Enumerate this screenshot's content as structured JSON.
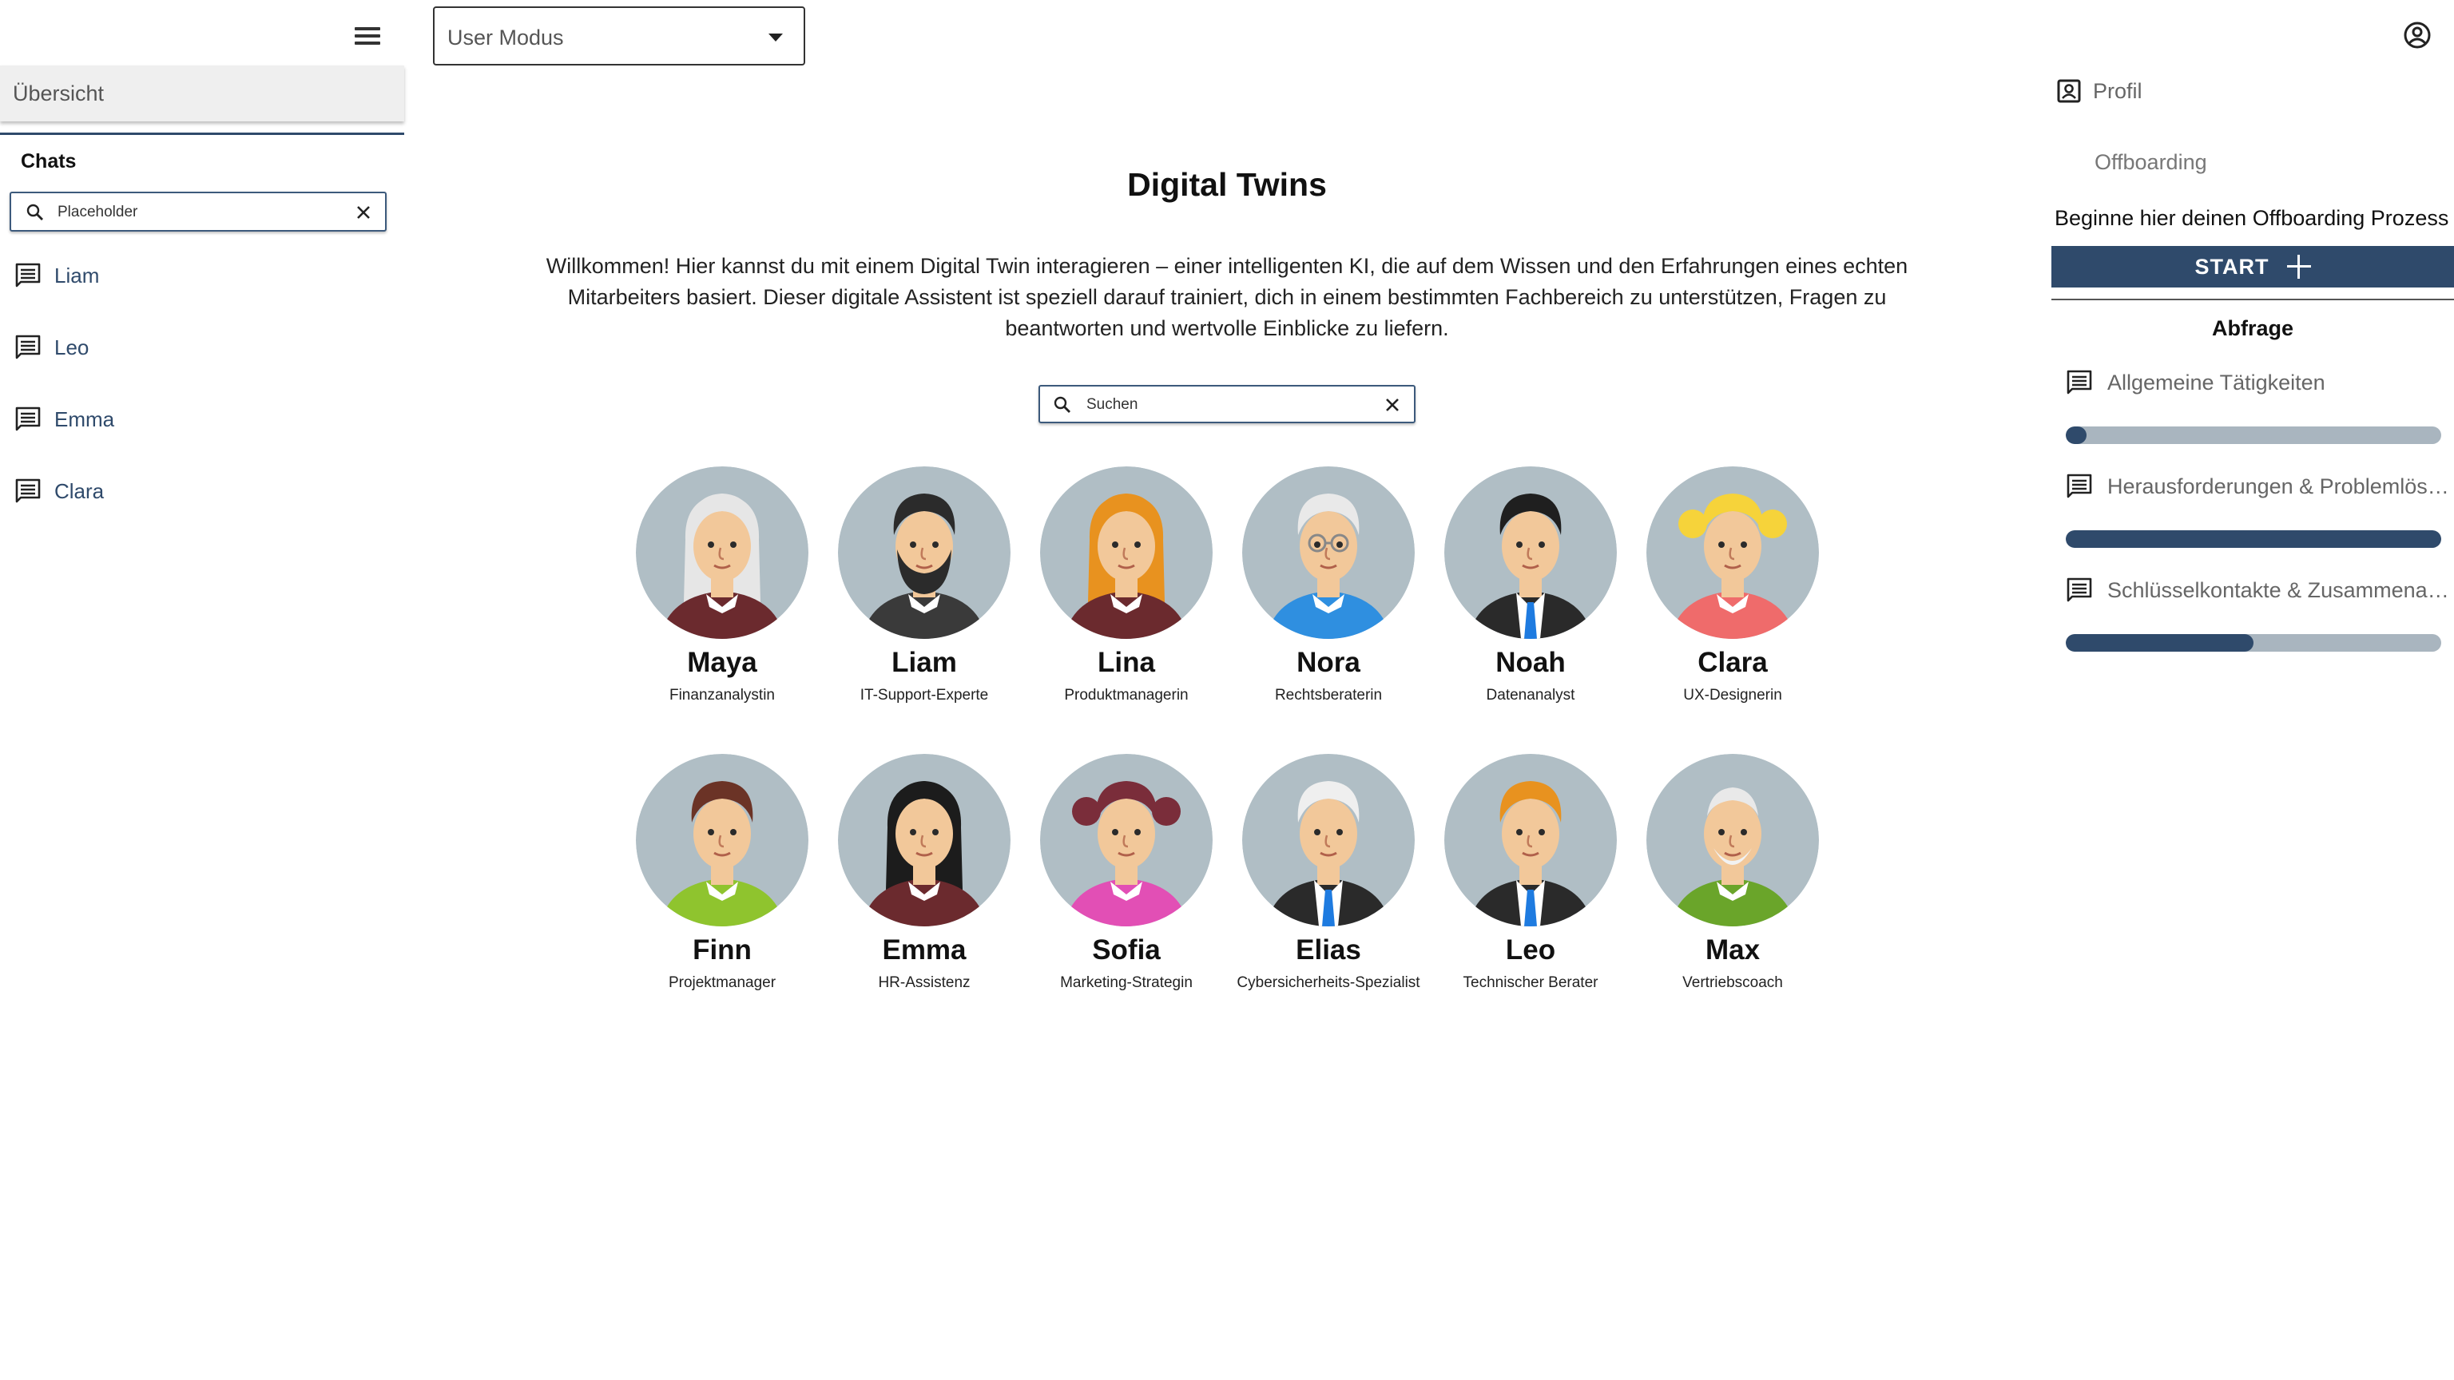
{
  "sidebar": {
    "overview_label": "Übersicht",
    "chats_title": "Chats",
    "search_placeholder": "Placeholder",
    "chats": [
      {
        "label": "Liam"
      },
      {
        "label": "Leo"
      },
      {
        "label": "Emma"
      },
      {
        "label": "Clara"
      }
    ]
  },
  "topbar": {
    "mode_value": "User Modus"
  },
  "main": {
    "title": "Digital Twins",
    "intro": "Willkommen! Hier kannst du mit einem Digital Twin interagieren – einer intelligenten KI, die auf dem Wissen und den Erfahrungen eines echten Mitarbeiters basiert. Dieser digitale Assistent ist speziell darauf trainiert, dich in einem bestimmten Fachbereich zu unterstützen, Fragen zu beantworten und wertvolle Einblicke zu liefern.",
    "search_placeholder": "Suchen",
    "twins": [
      {
        "name": "Maya",
        "role": "Finanzanalystin",
        "hair": "#e6e6e6",
        "shirt": "#6b2a2e",
        "style": "long-light"
      },
      {
        "name": "Liam",
        "role": "IT-Support-Experte",
        "hair": "#2b2b2b",
        "shirt": "#3a3a3a",
        "style": "beard"
      },
      {
        "name": "Lina",
        "role": "Produktmanagerin",
        "hair": "#e8921f",
        "shirt": "#6b2a2e",
        "style": "long"
      },
      {
        "name": "Nora",
        "role": "Rechtsberaterin",
        "hair": "#e9e9e9",
        "shirt": "#2f8fe0",
        "style": "glasses"
      },
      {
        "name": "Noah",
        "role": "Datenanalyst",
        "hair": "#1f1f1f",
        "shirt": "#2a2a2a",
        "style": "suit"
      },
      {
        "name": "Clara",
        "role": "UX-Designerin",
        "hair": "#f6d33a",
        "shirt": "#ef6b6b",
        "style": "pigtails"
      },
      {
        "name": "Finn",
        "role": "Projektmanager",
        "hair": "#6b3326",
        "shirt": "#8fc42e",
        "style": "short"
      },
      {
        "name": "Emma",
        "role": "HR-Assistenz",
        "hair": "#1c1c1c",
        "shirt": "#6b2a2e",
        "style": "long-dark"
      },
      {
        "name": "Sofia",
        "role": "Marketing-Strategin",
        "hair": "#7a2d3a",
        "shirt": "#e24fb5",
        "style": "pigtails"
      },
      {
        "name": "Elias",
        "role": "Cybersicherheits-Spezialist",
        "hair": "#efefef",
        "shirt": "#2a2a2a",
        "style": "suit"
      },
      {
        "name": "Leo",
        "role": "Technischer Berater",
        "hair": "#e8921f",
        "shirt": "#2a2a2a",
        "style": "suit"
      },
      {
        "name": "Max",
        "role": "Vertriebscoach",
        "hair": "#e9e9e9",
        "shirt": "#6aa52a",
        "style": "old"
      }
    ]
  },
  "right_panel": {
    "profile_label": "Profil",
    "offboarding_label": "Offboarding",
    "offboarding_message": "Beginne hier deinen Offboarding Prozess",
    "start_label": "START",
    "abfrage_title": "Abfrage",
    "queries": [
      {
        "label": "Allgemeine Tätigkeiten",
        "progress": 0.05
      },
      {
        "label": "Herausforderungen & Problemlösungen",
        "progress": 1.0
      },
      {
        "label": "Schlüsselkontakte & Zusammenarbeit",
        "progress": 0.5
      }
    ]
  },
  "colors": {
    "accent": "#2f4a6b",
    "progress_track": "#a9b5bf",
    "avatar_bg": "#b0bec5",
    "skin": "#f2c89a"
  }
}
